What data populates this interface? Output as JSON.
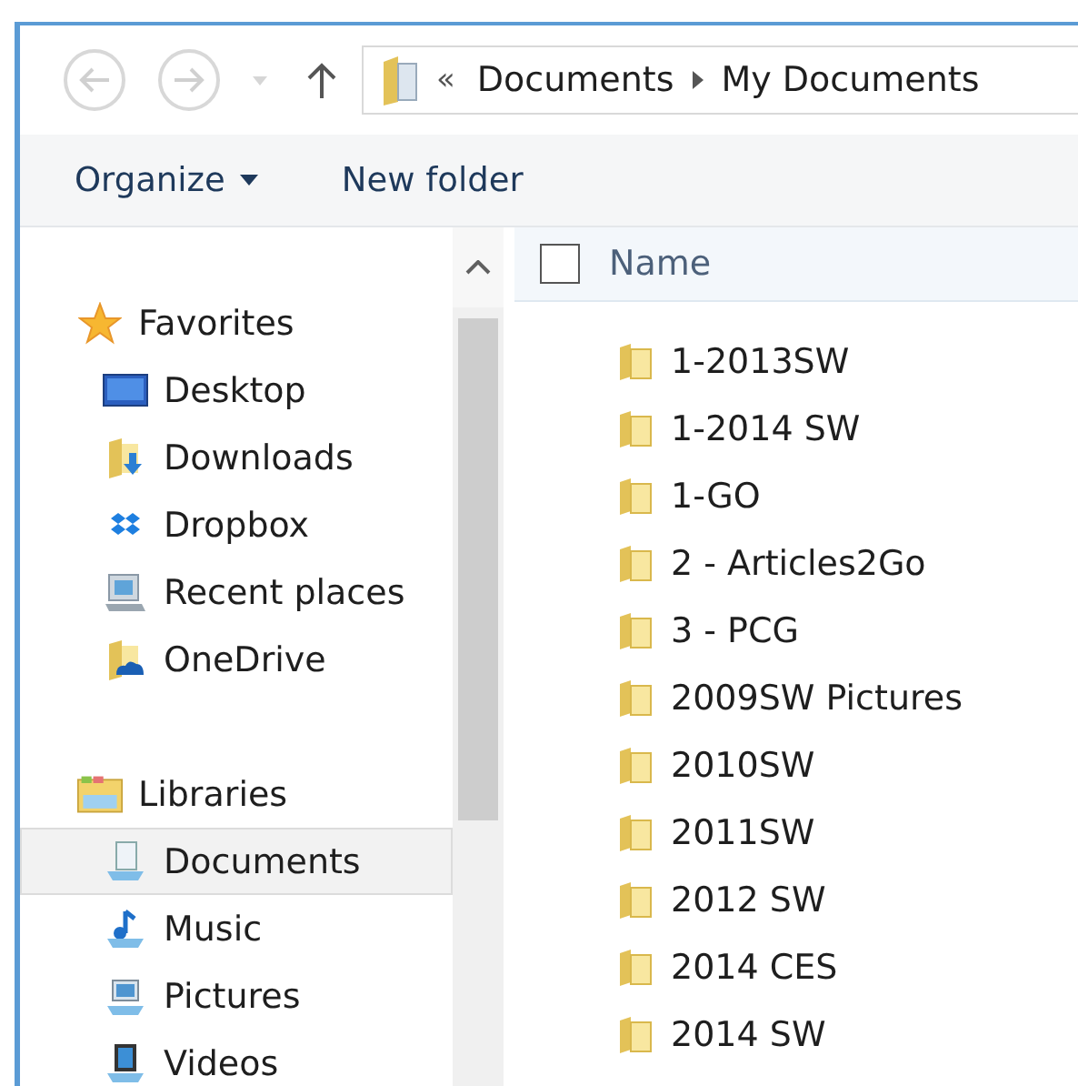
{
  "address_bar": {
    "overflow": "«",
    "path": [
      "Documents",
      "My Documents"
    ]
  },
  "toolbar": {
    "organize": "Organize",
    "new_folder": "New folder"
  },
  "sidebar": {
    "items": [
      {
        "kind": "group",
        "label": "Favorites",
        "selected": false
      },
      {
        "kind": "item",
        "label": "Desktop",
        "selected": false
      },
      {
        "kind": "item",
        "label": "Downloads",
        "selected": false
      },
      {
        "kind": "item",
        "label": "Dropbox",
        "selected": false
      },
      {
        "kind": "item",
        "label": "Recent places",
        "selected": false
      },
      {
        "kind": "item",
        "label": "OneDrive",
        "selected": false
      },
      {
        "kind": "gap"
      },
      {
        "kind": "group",
        "label": "Libraries",
        "selected": false
      },
      {
        "kind": "item",
        "label": "Documents",
        "selected": true
      },
      {
        "kind": "item",
        "label": "Music",
        "selected": false
      },
      {
        "kind": "item",
        "label": "Pictures",
        "selected": false
      },
      {
        "kind": "item",
        "label": "Videos",
        "selected": false
      }
    ]
  },
  "file_list": {
    "columns": [
      "Name"
    ],
    "select_all_checked": false,
    "rows": [
      {
        "name": "1-2013SW"
      },
      {
        "name": "1-2014 SW"
      },
      {
        "name": "1-GO"
      },
      {
        "name": "2 - Articles2Go"
      },
      {
        "name": "3 - PCG"
      },
      {
        "name": "2009SW Pictures"
      },
      {
        "name": "2010SW"
      },
      {
        "name": "2011SW"
      },
      {
        "name": "2012 SW"
      },
      {
        "name": "2014 CES"
      },
      {
        "name": "2014 SW"
      }
    ]
  }
}
